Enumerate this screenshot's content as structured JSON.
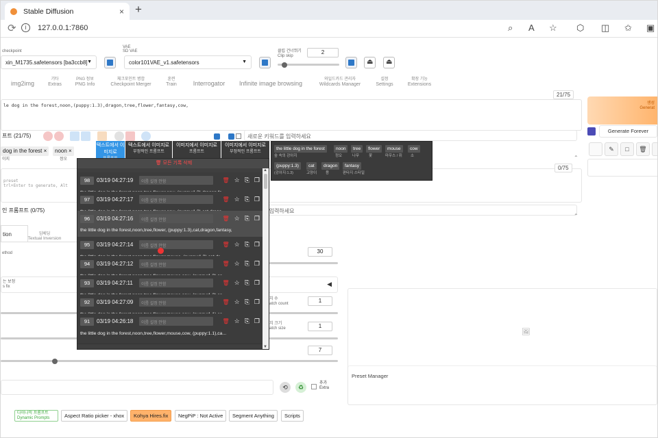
{
  "browser": {
    "tab_title": "Stable Diffusion",
    "tab_close": "×",
    "new_tab": "+",
    "url": "127.0.0.1:7860",
    "icons": [
      "zoom-icon",
      "read-aloud-icon",
      "favorite-icon",
      "extension-icon",
      "split-screen-icon",
      "favorites-bar-icon",
      "collections-icon"
    ]
  },
  "top": {
    "checkpoint_label": "checkpoint",
    "checkpoint_value": "xin_M1735.safetensors [ba3ccb8]",
    "vae_label_ko": "VAE",
    "vae_label_en": "SD VAE",
    "vae_value": "color101VAE_v1.safetensors",
    "clip_label_ko": "클립 건너뛰기",
    "clip_label_en": "Clip skip",
    "clip_value": "2"
  },
  "main_tabs": [
    {
      "ko": "",
      "en": "img2img"
    },
    {
      "ko": "기타",
      "en": "Extras"
    },
    {
      "ko": "PNG 정보",
      "en": "PNG Info"
    },
    {
      "ko": "체크포인트 병합",
      "en": "Checkpoint Merger"
    },
    {
      "ko": "훈련",
      "en": "Train"
    },
    {
      "ko": "",
      "en": "Interrogator"
    },
    {
      "ko": "",
      "en": "Infinite image browsing"
    },
    {
      "ko": "와일드카드 관리자",
      "en": "Wildcards Manager"
    },
    {
      "ko": "설정",
      "en": "Settings"
    },
    {
      "ko": "확장 기능",
      "en": "Extensions"
    }
  ],
  "prompt": {
    "text": "le dog in the forest,noon,(puppy:1.3),dragon,tree,flower,fantasy,cow,",
    "counter": "21/75",
    "label": "프트 (21/75)",
    "tag_input_placeholder": "새로운 키워드를 입력하세요",
    "neg_placeholder_1": "preset",
    "neg_placeholder_2": "trl+Enter to generate, Alt",
    "neg_counter": "0/75",
    "neg_label": "인 프롬프트 (0/75)",
    "neg_tag_input_placeholder": "키워드를 입력하세요",
    "chips": [
      {
        "text": "dog in the forest",
        "x": "×"
      },
      {
        "text": "noon",
        "x": "×"
      }
    ],
    "chip_sub": [
      "이지",
      "정오"
    ]
  },
  "generate": {
    "label_ko": "생성",
    "label_en": "Generat",
    "forever": "Generate Forever"
  },
  "category_tabs": [
    {
      "a": "텍스트에서 이미지로",
      "b": "프롬프트"
    },
    {
      "a": "텍스트에서 이미지로",
      "b": "부정적인 프롬프트"
    },
    {
      "a": "이미지에서 이미지로",
      "b": "프롬프트"
    },
    {
      "a": "이미지에서 이미지로",
      "b": "부정적인 프롬프트"
    }
  ],
  "history": {
    "header": "모든 기록 삭제",
    "memo_placeholder": "이름 설정 안함",
    "items": [
      {
        "num": "98",
        "date": "03/19 04:27:19",
        "text": "the little dog in the forest,noon,tree,flower,cow, (puppy:1.3),dragon,fa..."
      },
      {
        "num": "97",
        "date": "03/19 04:27:17",
        "text": "the little dog in the forest,noon,tree,flower,cow, (puppy:1.3),cat,drago..."
      },
      {
        "num": "96",
        "date": "03/19 04:27:16",
        "text": "the little dog in the forest,noon,tree,flower, (puppy:1.3),cat,dragon,fantasy,"
      },
      {
        "num": "95",
        "date": "03/19 04:27:14",
        "text": "the little dog in the forest,noon,tree,flower,mouse, (puppy:1.3),cat,dr..."
      },
      {
        "num": "94",
        "date": "03/19 04:27:12",
        "text": "the little dog in the forest,noon,tree,flower,mouse,cow, (puppy:1.3),ca..."
      },
      {
        "num": "93",
        "date": "03/19 04:27:11",
        "text": "the little dog in the forest,noon,tree,flower,mouse,cow, (puppy:1.2),ca..."
      },
      {
        "num": "92",
        "date": "03/19 04:27:09",
        "text": "the little dog in the forest,noon,tree,flower,mouse,cow, (puppy:1.1),ca..."
      },
      {
        "num": "91",
        "date": "03/19 04:26:18",
        "text": "the little dog in the forest,noon,tree,flower,mouse,cow, (puppy:1.1),ca..."
      }
    ]
  },
  "tag_panel": {
    "row1": [
      {
        "en": "the little dog in the forest",
        "ko": "숲 속의 강아지"
      },
      {
        "en": "noon",
        "ko": "정오"
      },
      {
        "en": "tree",
        "ko": "나무"
      },
      {
        "en": "flower",
        "ko": "꽃"
      },
      {
        "en": "mouse",
        "ko": "마우스 / 쥐"
      },
      {
        "en": "cow",
        "ko": "소"
      }
    ],
    "row2": [
      {
        "en": "(puppy:1.3)",
        "ko": "(강아지:1.3)"
      },
      {
        "en": "cat",
        "ko": "고양이"
      },
      {
        "en": "dragon",
        "ko": "용"
      },
      {
        "en": "fantasy",
        "ko": "판타지 스타일"
      }
    ]
  },
  "left_fields": {
    "tab_a": "tion",
    "tab_b_ko": "임베딩",
    "tab_b_en": "Textual Inversion",
    "method": "ethod",
    "hires_ko": "는 보정",
    "hires_en": "s fix",
    "steps": "30",
    "batch_count_ko": "치 수",
    "batch_count_en": "atch count",
    "batch_count": "1",
    "batch_size_ko": "치 크기",
    "batch_size_en": "atch size",
    "batch_size": "1",
    "cfg": "7",
    "arrow": "◀"
  },
  "extras_label": {
    "ko": "추가",
    "en": "Extra"
  },
  "preset_manager": "Preset Manager",
  "extensions": [
    {
      "label": "다이나믹 프롬프트\nDynamic Prompts"
    },
    {
      "label": "Aspect Ratio picker - xhox"
    },
    {
      "label": "Kohya Hires.fix"
    },
    {
      "label": "NegPiP : Not Active"
    },
    {
      "label": "Segment Anything"
    },
    {
      "label": "Scripts"
    }
  ],
  "colors": {
    "accent_blue": "#3395e6",
    "generate_orange": "#ffb46c",
    "delete_red": "#e33333",
    "panel_dark": "#3f3f3f"
  }
}
